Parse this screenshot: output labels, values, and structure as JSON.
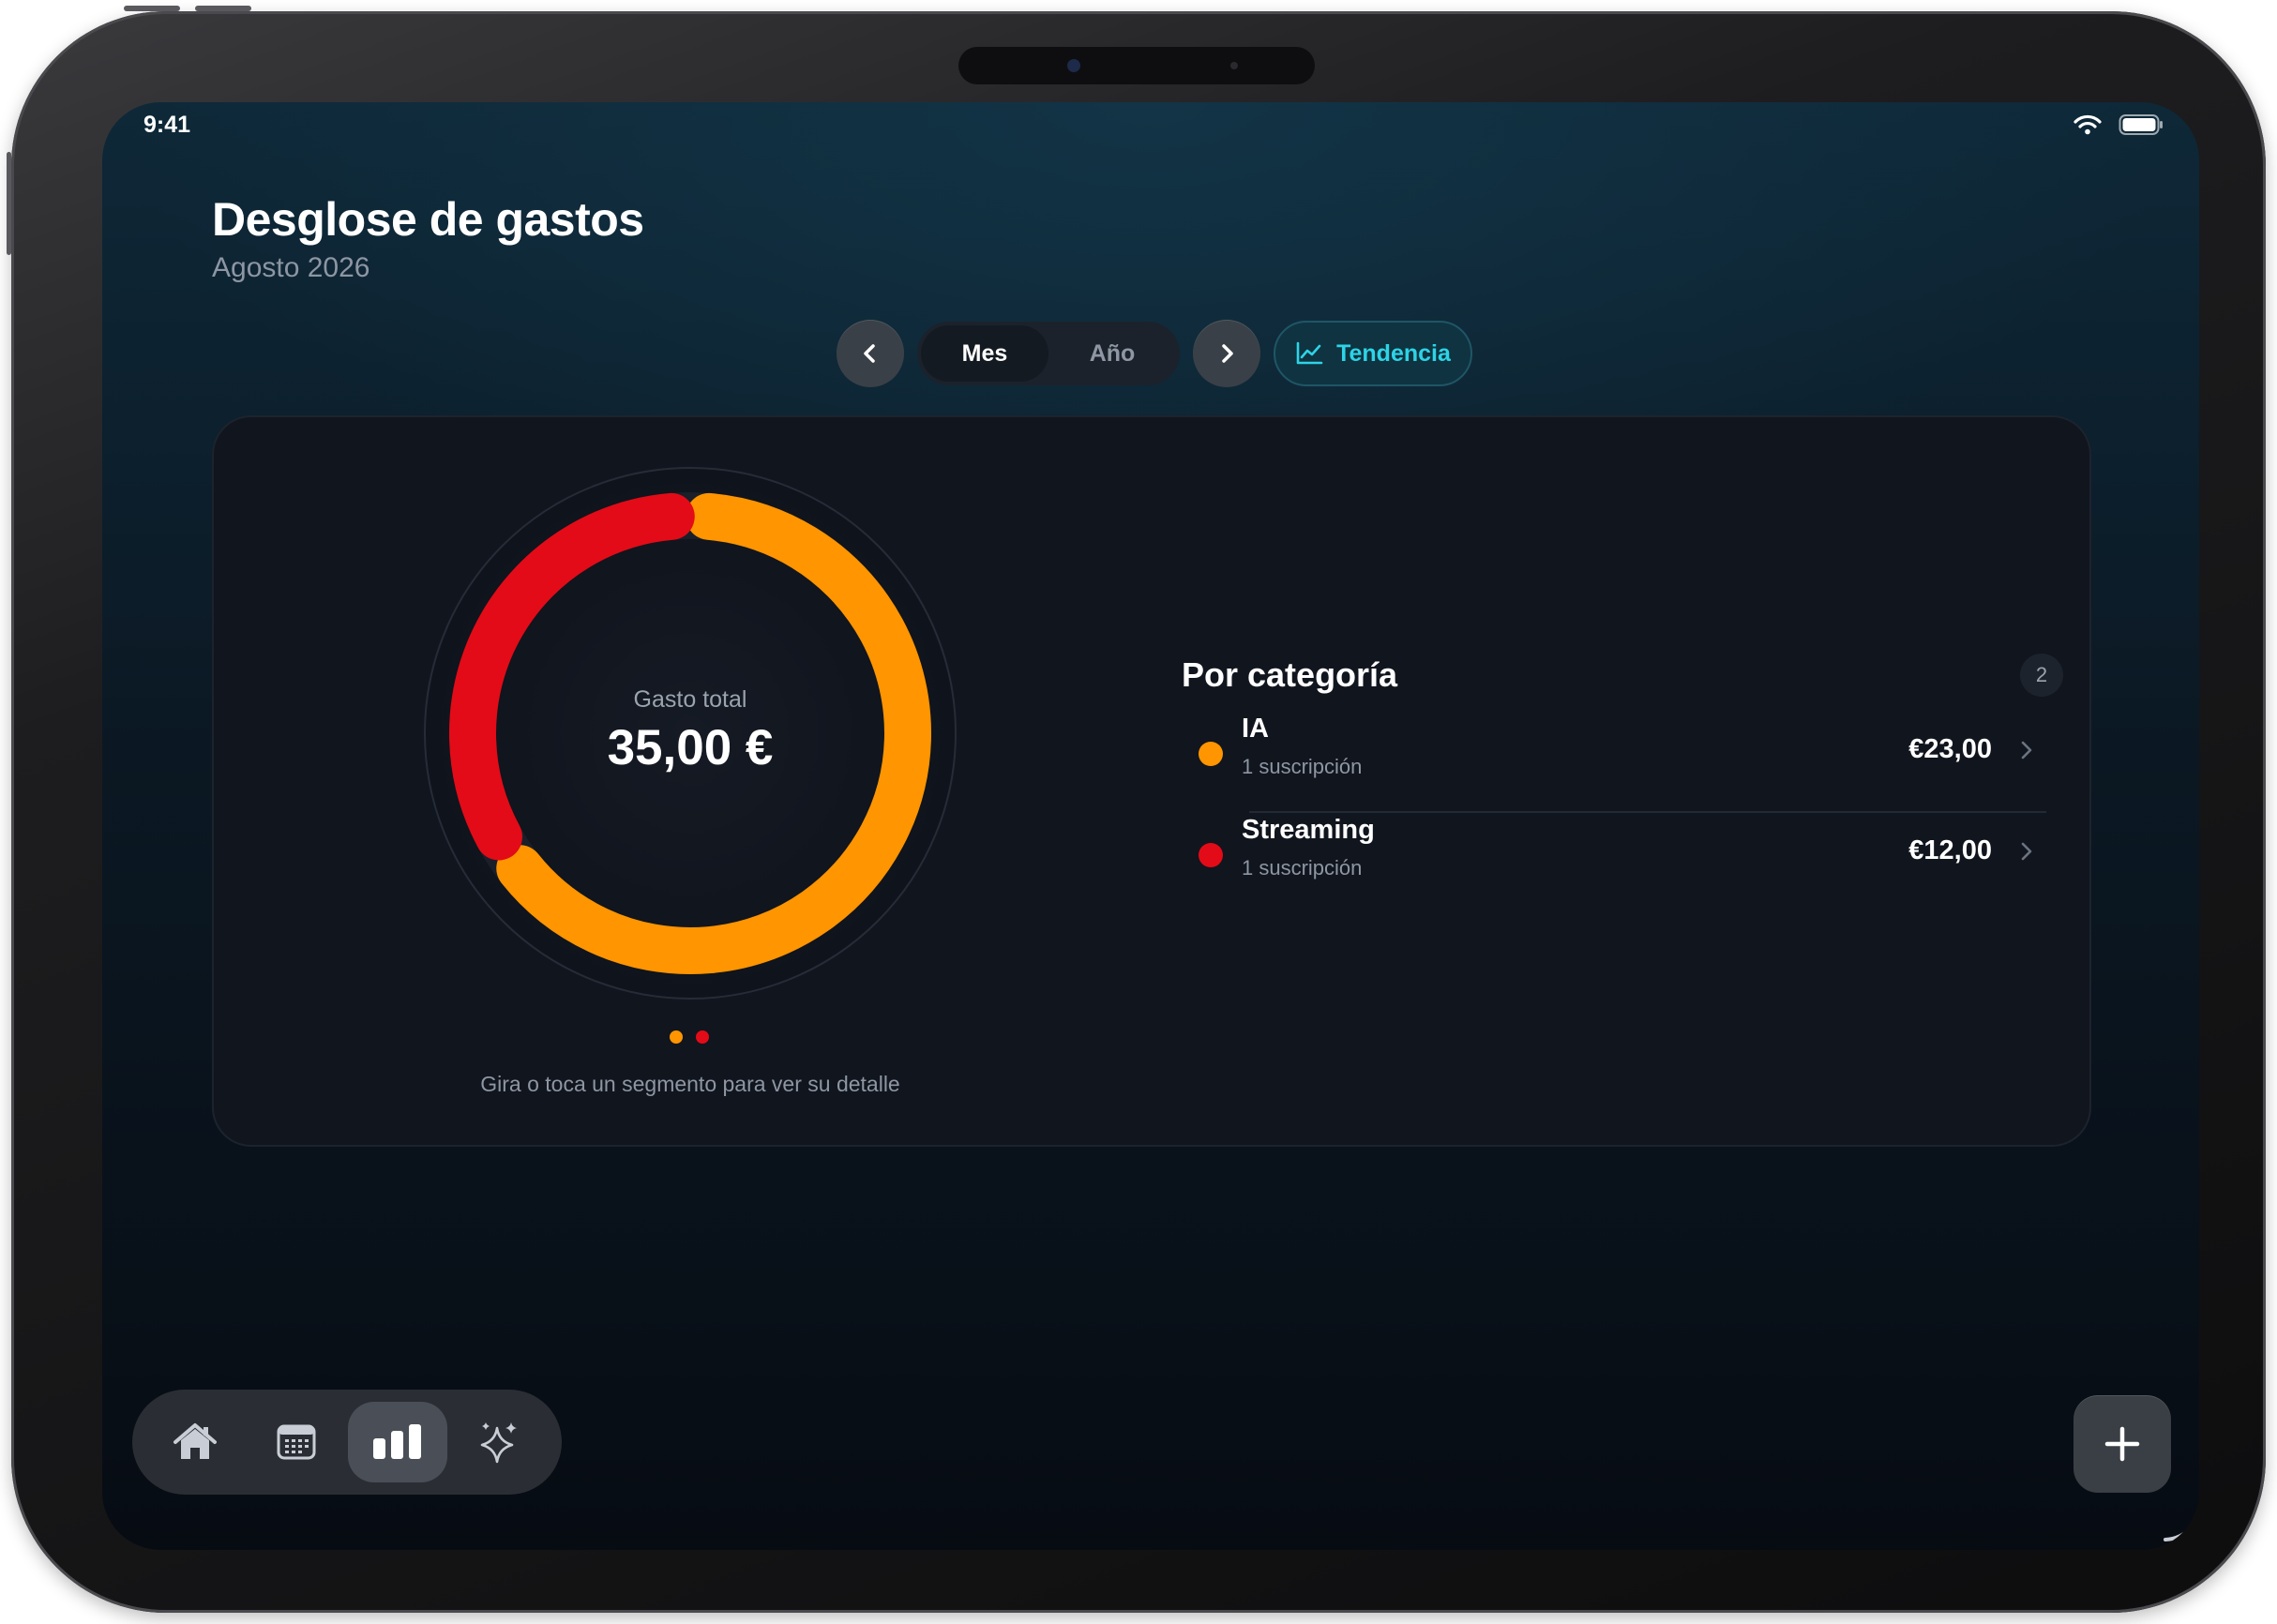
{
  "status_bar": {
    "time": "9:41",
    "wifi_icon": "wifi-icon",
    "battery_icon": "battery-icon"
  },
  "header": {
    "title": "Desglose de gastos",
    "subtitle": "Agosto 2026"
  },
  "period_control": {
    "prev_icon": "chevron-left-icon",
    "next_icon": "chevron-right-icon",
    "options": [
      "Mes",
      "Año"
    ],
    "selected": "Mes",
    "trend_label": "Tendencia",
    "trend_icon": "line-chart-icon"
  },
  "summary": {
    "total_label": "Gasto total",
    "total_value": "35,00 €",
    "hint": "Gira o toca un segmento para ver su detalle"
  },
  "chart_data": {
    "type": "pie",
    "style": "donut",
    "categories": [
      "IA",
      "Streaming"
    ],
    "values": [
      23.0,
      12.0
    ],
    "colors": [
      "#ff9500",
      "#e30b17"
    ]
  },
  "categories_panel": {
    "title": "Por categoría",
    "count": "2",
    "items": [
      {
        "name": "IA",
        "detail": "1 suscripción",
        "amount": "€23,00",
        "color": "#ff9500"
      },
      {
        "name": "Streaming",
        "detail": "1 suscripción",
        "amount": "€12,00",
        "color": "#e30b17"
      }
    ]
  },
  "tabbar": {
    "items": [
      {
        "icon": "home-icon",
        "active": false
      },
      {
        "icon": "calendar-icon",
        "active": false
      },
      {
        "icon": "bar-chart-icon",
        "active": true
      },
      {
        "icon": "sparkles-icon",
        "active": false
      }
    ],
    "add_icon": "plus-icon"
  },
  "colors": {
    "accent": "#2ed3e6",
    "ia": "#ff9500",
    "streaming": "#e30b17"
  }
}
